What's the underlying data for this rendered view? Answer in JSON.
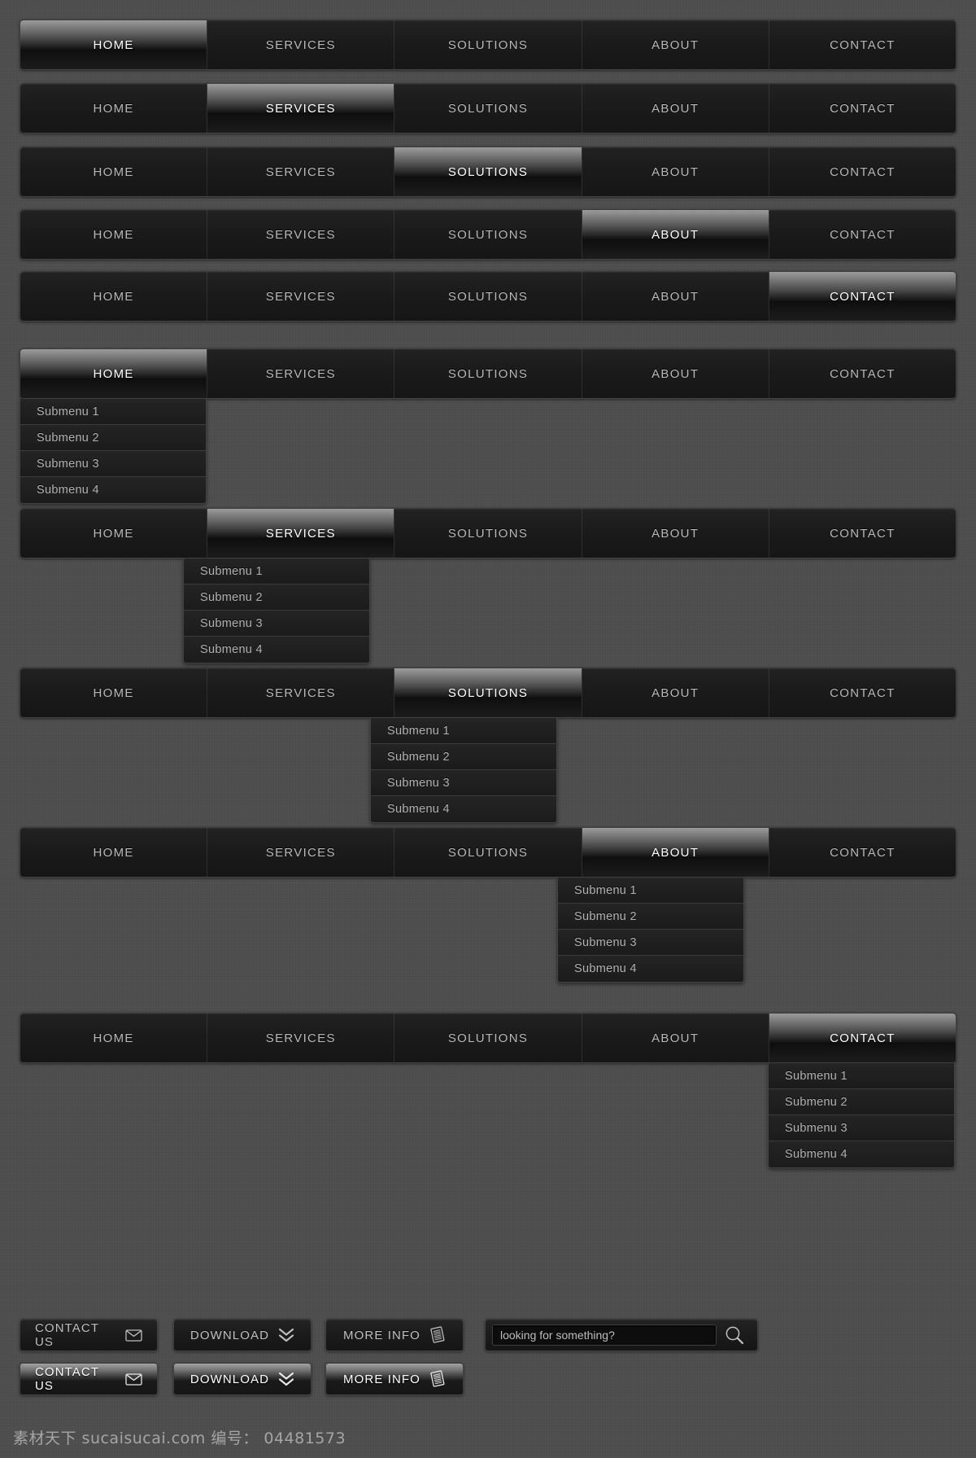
{
  "nav": {
    "items": [
      "HOME",
      "SERVICES",
      "SOLUTIONS",
      "ABOUT",
      "CONTACT"
    ],
    "submenu_items": [
      "Submenu 1",
      "Submenu 2",
      "Submenu 3",
      "Submenu 4"
    ]
  },
  "bars": [
    {
      "active_index": 0,
      "submenu_open": false
    },
    {
      "active_index": 1,
      "submenu_open": false
    },
    {
      "active_index": 2,
      "submenu_open": false
    },
    {
      "active_index": 3,
      "submenu_open": false
    },
    {
      "active_index": 4,
      "submenu_open": false
    },
    {
      "active_index": 0,
      "submenu_open": true
    },
    {
      "active_index": 1,
      "submenu_open": true
    },
    {
      "active_index": 2,
      "submenu_open": true
    },
    {
      "active_index": 3,
      "submenu_open": true
    },
    {
      "active_index": 4,
      "submenu_open": true
    }
  ],
  "labels": {
    "home": "HOME",
    "services": "SERVICES",
    "solutions": "SOLUTIONS",
    "about": "ABOUT",
    "contact": "CONTACT",
    "sub1": "Submenu 1",
    "sub2": "Submenu 2",
    "sub3": "Submenu 3",
    "sub4": "Submenu 4"
  },
  "buttons": {
    "contact_us": "CONTACT US",
    "download": "DOWNLOAD",
    "more_info": "MORE INFO",
    "contact_us_icon": "envelope-icon",
    "download_icon": "double-chevron-down-icon",
    "more_info_icon": "document-lines-icon"
  },
  "search": {
    "placeholder": "looking for something?",
    "value": "",
    "icon": "magnifier-icon"
  },
  "watermark": {
    "text": "素材天下 sucaisucai.com  编号： 04481573"
  },
  "colors": {
    "background": "#4d4d4d",
    "bar_dark": "#1b1b1b",
    "highlight_top": "#9b9b9b",
    "text": "#b9b9b9",
    "text_active": "#ffffff"
  }
}
